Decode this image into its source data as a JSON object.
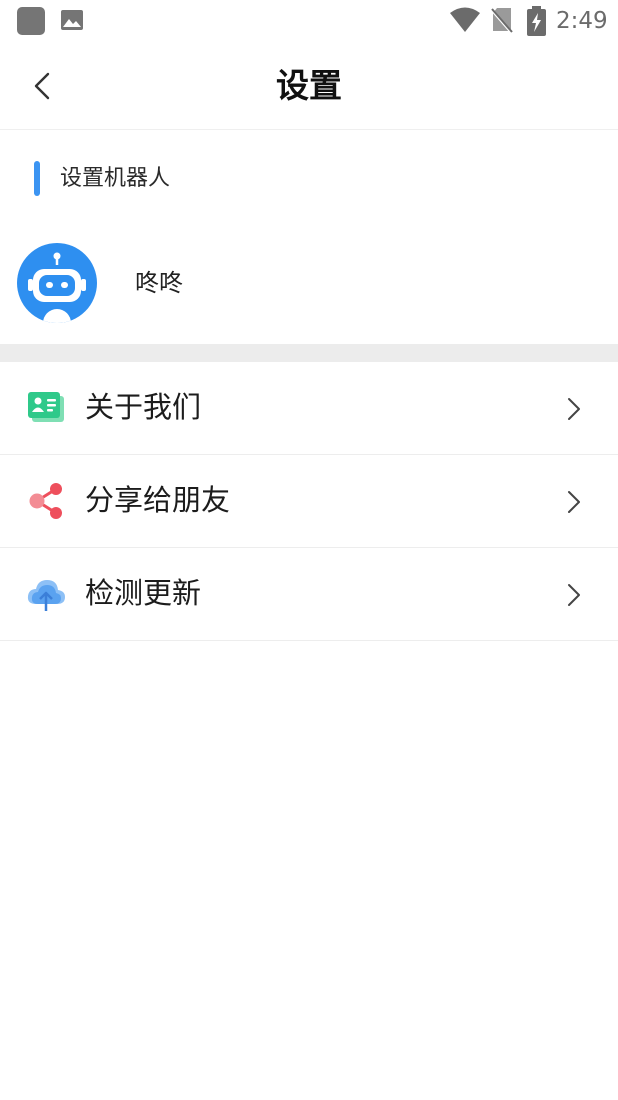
{
  "status_bar": {
    "time": "2:49",
    "icons": [
      "notification-square-icon",
      "image-icon",
      "wifi-icon",
      "no-sim-icon",
      "battery-charging-icon"
    ]
  },
  "header": {
    "title": "设置",
    "back_icon": "chevron-left-icon"
  },
  "robot_section": {
    "title": "设置机器人",
    "accent_color": "#3b94f2",
    "robot": {
      "name": "咚咚",
      "avatar_icon": "robot-avatar-icon",
      "avatar_color": "#2e8ff0"
    }
  },
  "menu": {
    "items": [
      {
        "label": "关于我们",
        "icon": "id-card-icon",
        "icon_color": "#2fc98a"
      },
      {
        "label": "分享给朋友",
        "icon": "share-icon",
        "icon_color": "#ee4f5c"
      },
      {
        "label": "检测更新",
        "icon": "cloud-upload-icon",
        "icon_color": "#5aa2f0"
      }
    ],
    "chevron_icon": "chevron-right-icon"
  }
}
